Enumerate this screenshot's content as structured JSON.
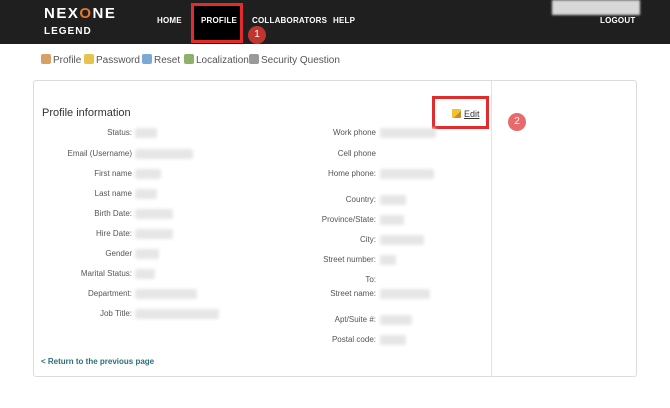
{
  "brand": {
    "name_main_1": "NEX",
    "name_accent": "O",
    "name_main_2": "NE",
    "name_sub": "LEGEND"
  },
  "nav": {
    "home": "HOME",
    "profile": "PROFILE",
    "collaborators": "COLLABORATORS",
    "help": "HELP",
    "logout": "LOGOUT"
  },
  "callouts": {
    "one": "1",
    "two": "2"
  },
  "subtabs": {
    "profile": "Profile",
    "password": "Password",
    "reset": "Reset",
    "localization": "Localization",
    "security_question": "Security Question"
  },
  "panel": {
    "title": "Profile information",
    "edit": "Edit",
    "left_labels": [
      "Status:",
      "Email (Username)",
      "First name",
      "Last name",
      "Birth Date:",
      "Hire Date:",
      "Gender",
      "Marital Status:",
      "Department:",
      "Job Title:"
    ],
    "right_labels": [
      "Work phone",
      "Cell phone",
      "Home phone:",
      "Country:",
      "Province/State:",
      "City:",
      "Street number:",
      "To:",
      "Street name:",
      "Apt/Suite #:",
      "Postal code:"
    ]
  },
  "return_link": "< Return to the previous page",
  "colors": {
    "highlight": "#e32b2b",
    "accent": "#e8762b",
    "link": "#2a6f7a"
  }
}
